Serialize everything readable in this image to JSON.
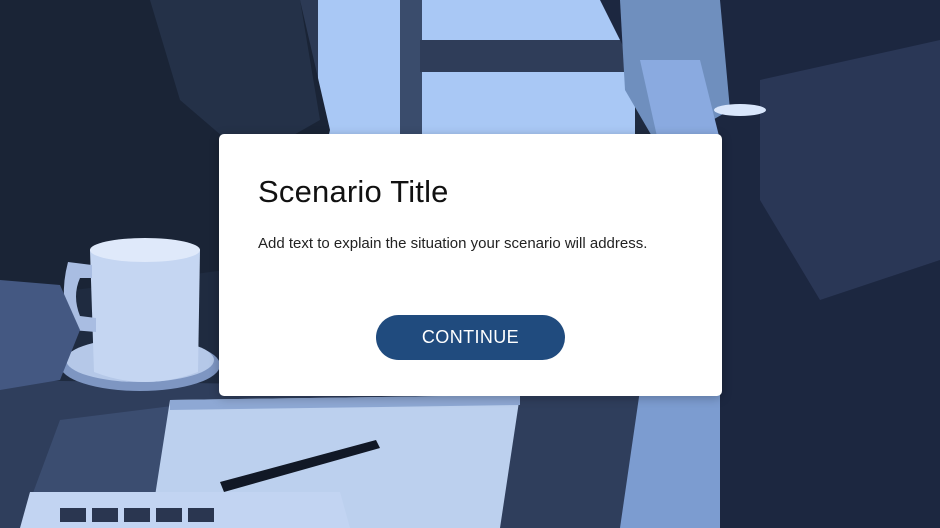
{
  "modal": {
    "title": "Scenario Title",
    "body": "Add text to explain the situation your scenario will address.",
    "continue_label": "CONTINUE"
  },
  "colors": {
    "modal_background": "#ffffff",
    "button_background": "#204b7e",
    "button_text": "#ffffff",
    "photo_tint_dark": "#1e2a3f",
    "photo_tint_light": "#9ec1f2"
  },
  "background": {
    "icon": "photo-background"
  }
}
